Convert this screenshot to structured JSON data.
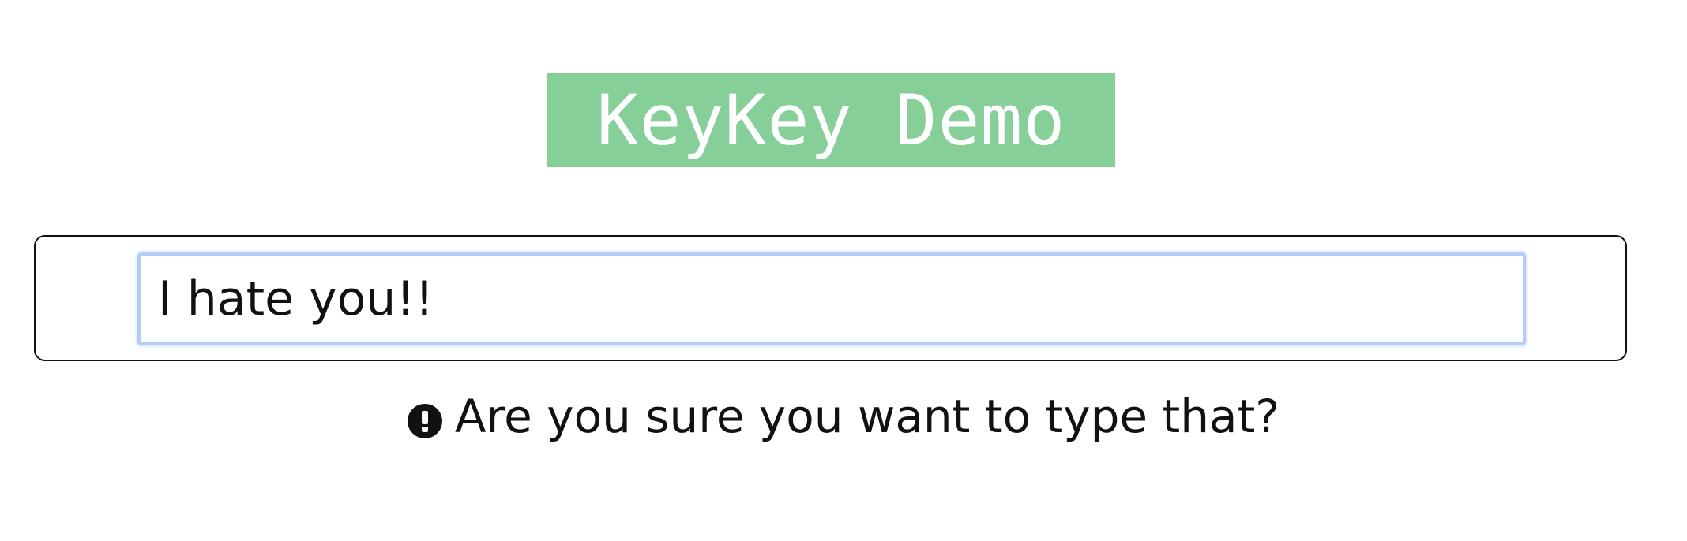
{
  "header": {
    "title": "KeyKey Demo",
    "banner_color": "#86cf98"
  },
  "input": {
    "value": "I hate you!!",
    "focus_color": "#b3cdf3"
  },
  "warning": {
    "icon": "exclamation-circle-icon",
    "message": "Are you sure you want to type that?"
  }
}
